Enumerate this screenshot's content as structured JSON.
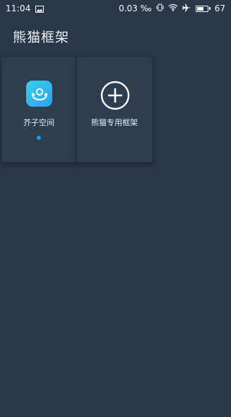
{
  "status_bar": {
    "time": "11:04",
    "network_speed": "0.03 ‰",
    "battery_level": "67",
    "battery_fraction": 0.67,
    "icons": [
      "gallery-icon",
      "vibrate-icon",
      "wifi-icon",
      "airplane-icon",
      "battery-icon"
    ]
  },
  "header": {
    "title": "熊猫框架"
  },
  "tiles": [
    {
      "label": "芥子空间",
      "icon": "app-icon",
      "active": true
    },
    {
      "label": "熊猫专用框架",
      "icon": "add-circle-icon"
    }
  ],
  "colors": {
    "background": "#2a374b",
    "tile": "#2f3d51",
    "accent": "#1e9bf0",
    "app_icon_gradient": [
      "#36d0ee",
      "#2ea2ea"
    ]
  }
}
